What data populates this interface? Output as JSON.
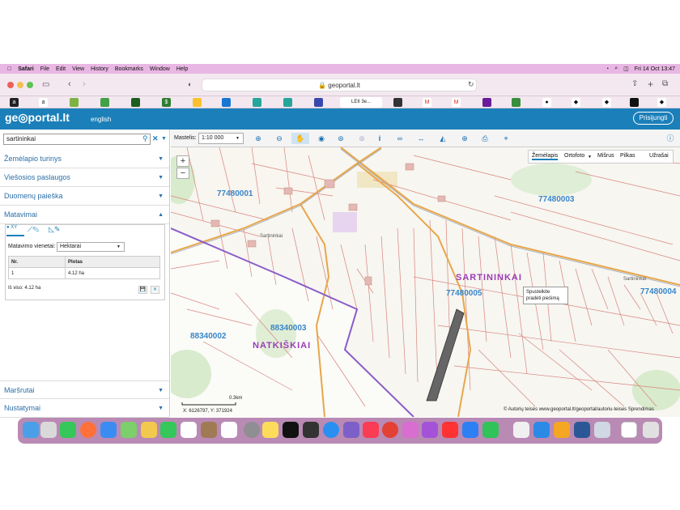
{
  "menubar": {
    "app": "Safari",
    "items": [
      "File",
      "Edit",
      "View",
      "History",
      "Bookmarks",
      "Window",
      "Help"
    ],
    "datetime": "Fri 14 Oct  13:47"
  },
  "browser": {
    "url": "geoportal.lt",
    "active_tab_label": "LEII 3e..."
  },
  "header": {
    "logo": "ge◎portal.lt",
    "language": "english",
    "login": "Prisijungti"
  },
  "sidebar": {
    "search_value": "sartininkai",
    "sections": [
      "Žemėlapio turinys",
      "Viešosios paslaugos",
      "Duomenų paieška",
      "Matavimai"
    ],
    "bottom_sections": [
      "Maršrutai",
      "Nustatymai"
    ],
    "measure": {
      "tab1": "XY",
      "unit_label": "Matavimo vienetai:",
      "unit_value": "Hektarai",
      "col_nr": "Nr.",
      "col_area": "Plotas",
      "row_nr": "1",
      "row_area": "4.12 ha",
      "total": "Iš viso: 4.12 ha"
    }
  },
  "maptoolbar": {
    "scale_label": "Mastelis:",
    "scale_value": "1:10 000"
  },
  "map": {
    "layers": [
      "Žemėlapis",
      "Ortofoto",
      "Mišrus",
      "Pilkas",
      "Užrašai"
    ],
    "labels": {
      "z1": "77480001",
      "z2": "77480003",
      "z3": "77480005",
      "z4": "77480004",
      "z5": "88340002",
      "z6": "88340003",
      "town1": "SARTININKAI",
      "town2": "NATKIŠKIAI",
      "village": "Sartininkai",
      "village2": "Sartininkai"
    },
    "tooltip_line1": "Spustelkite",
    "tooltip_line2": "pradėti piešimą",
    "scalebar": "0.3km",
    "coords": "X: 6126797, Y: 371924",
    "copyright": "© Autorių teisės  www.geoportal.lt/geoportal/autoriu-teises   Sprendimas"
  },
  "colors": {
    "header": "#1b7fb9",
    "menubar": "#e9b7e4",
    "parcel_lines": "#d9847d",
    "boundary": "#8a5cc8",
    "road": "#e8a64a",
    "label_blue": "#3a86c8",
    "label_purple": "#9b3cb8"
  }
}
